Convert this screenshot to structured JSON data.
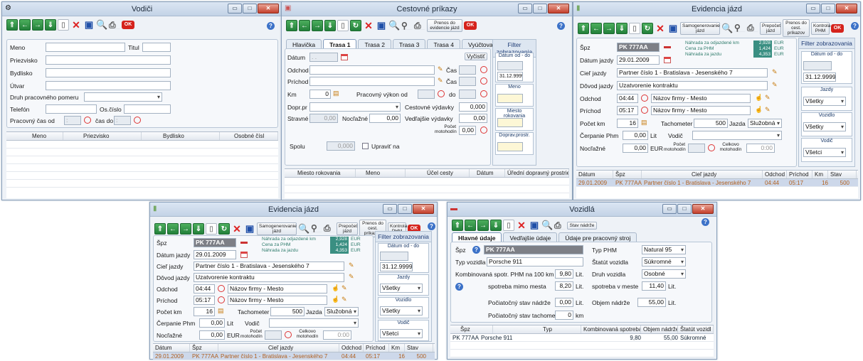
{
  "vodici": {
    "title": "Vodiči",
    "labels": {
      "meno": "Meno",
      "titul": "Titul",
      "priezvisko": "Priezvisko",
      "bydlisko": "Bydlisko",
      "utvar": "Útvar",
      "druh": "Druh pracovného pomeru",
      "telefon": "Telefón",
      "os_cislo": "Os.číslo",
      "pracovny": "Pracovný čas od",
      "cas_do": "čas do"
    },
    "time_placeholder": ": ",
    "columns": [
      "Meno",
      "Priezvisko",
      "Bydlisko",
      "Osobné čísl"
    ]
  },
  "cestovne": {
    "title": "Cestovné príkazy",
    "tb_prenos": "Prenos do evidencie jázd",
    "tabs": [
      "Hlavička",
      "Trasa 1",
      "Trasa 2",
      "Trasa 3",
      "Trasa 4",
      "Vyúčtovanie"
    ],
    "labels": {
      "datum": "Dátum",
      "odchod": "Odchod",
      "prichod": "Príchod",
      "km": "Km",
      "pracovny_vykon": "Pracovný výkon od",
      "do": "do",
      "cas": "Čas",
      "dopr": "Dopr.pr",
      "cestovne_vydavky": "Cestovné výdavky",
      "stravne": "Stravné",
      "noclazne": "Nocľažné",
      "vedlajsie": "Vedľajšie výdavky",
      "pocet_motohodin": "Počet motohodín",
      "spolu": "Spolu",
      "upravit": "Upraviť na"
    },
    "values": {
      "km": "0",
      "cest_vyd": "0,000",
      "stravne": "0,00",
      "noclazne": "0,00",
      "vedl_vyd": "0,00",
      "motohodin": "0,00",
      "spolu": "0,000",
      "date_ph": ". ."
    },
    "vycistit": "Vyčistiť",
    "filter": {
      "title": "Filter zobrazovania",
      "datum": "Dátum od - do",
      "date_to": "31.12.9999",
      "meno": "Meno",
      "miesto": "Miesto rokovania",
      "doprav": "Doprav.prostr."
    },
    "columns": [
      "Miesto rokovania",
      "Meno",
      "Účel cesty",
      "Dátum",
      "Úřední dopravný prostriedok"
    ]
  },
  "evidencia": {
    "title": "Evidencia jázd",
    "tb_samogen": "Samogenerovanie jázd",
    "tb_prepocet": "Prepočet jázd",
    "tb_prenos": "Prenos do cest. príkazov",
    "tb_kontrola": "Kontrola PHM",
    "labels": {
      "spz": "Špz",
      "datum": "Dátum jazdy",
      "ciel": "Cieľ jazdy",
      "dovod": "Dôvod jazdy",
      "odchod": "Odchod",
      "prichod": "Príchod",
      "pocet_km": "Počet km",
      "tachometer": "Tachometer",
      "jazda": "Jazda",
      "cerpanie": "Čerpanie Phm",
      "lit": "Lit",
      "vodic": "Vodič",
      "noclazne": "Nocľažné",
      "eur": "EUR",
      "pocet_moto": "Počet motohodín",
      "celkovo_moto": "Celkovo motohodín"
    },
    "info": {
      "nahrada_odjazdene": "Náhrada za odjazdené km",
      "cena_phm": "Cena za PHM",
      "nahrada_jazdu": "Náhrada za jazdu",
      "v1": "2,928",
      "v2": "1,424",
      "v3": "4,353",
      "eur": "EUR"
    },
    "values": {
      "spz": "PK 777AA",
      "datum": "29.01.2009",
      "ciel": "Partner číslo 1 - Bratislava - Jesenského 7",
      "dovod": "Uzatvorenie kontraktu",
      "odchod_cas": "04:44",
      "odchod_miesto": "Názov firmy - Mesto",
      "prichod_cas": "05:17",
      "prichod_miesto": "Názov firmy - Mesto",
      "pocet_km": "16",
      "tachometer": "500",
      "jazda": "Služobná",
      "cerpanie": "0,00",
      "noclazne": "0,00",
      "moto": "0:00"
    },
    "filter": {
      "title": "Filter zobrazovania",
      "datum": "Dátum od - do",
      "date_to": "31.12.9999",
      "jazdy": "Jazdy",
      "vsetky": "Všetky",
      "vozidlo": "Vozidlo",
      "vodic": "Vodič",
      "vsetci": "Všetci"
    },
    "columns": [
      "Dátum",
      "Špz",
      "Cieľ jazdy",
      "Odchod",
      "Príchod",
      "Km",
      "Stav"
    ],
    "row": [
      "29.01.2009",
      "PK 777AA",
      "Partner číslo 1 - Bratislava - Jesenského 7",
      "04:44",
      "05:17",
      "16",
      "500"
    ]
  },
  "vozidla": {
    "title": "Vozidlá",
    "tb_stav": "Stav nádrže",
    "tabs": [
      "Hlavné údaje",
      "Vedľajšie údaje",
      "Údaje pre pracovný stroj"
    ],
    "labels": {
      "spz": "Špz",
      "typ": "Typ vozidla",
      "komb": "Kombinovaná spotr. PHM na 100 km",
      "mimo": "spotreba mimo mesta",
      "lit": "Lit.",
      "typ_phm": "Typ PHM",
      "statut": "Štatút vozidla",
      "druh": "Druh vozidla",
      "v_meste": "spotreba v meste",
      "poc_nadrz": "Počiatočný stav nádrže",
      "objem": "Objem nádrže",
      "poc_tach": "Počiatočný stav tachometra",
      "km": "km"
    },
    "values": {
      "spz": "PK 777AA",
      "typ": "Porsche 911",
      "komb": "9,80",
      "mimo": "8,20",
      "typ_phm": "Natural 95",
      "statut": "Súkromné",
      "druh": "Osobné",
      "v_meste": "11,40",
      "poc_nadrz": "0,00",
      "objem": "55,00",
      "poc_tach": "0"
    },
    "columns": [
      "Špz",
      "Typ",
      "Kombinovaná spotreba",
      "Objem nádrže",
      "Štatút vozidl"
    ],
    "row": [
      "PK 777AA",
      "Porsche 911",
      "9,80",
      "55,00",
      "Súkromné"
    ]
  }
}
